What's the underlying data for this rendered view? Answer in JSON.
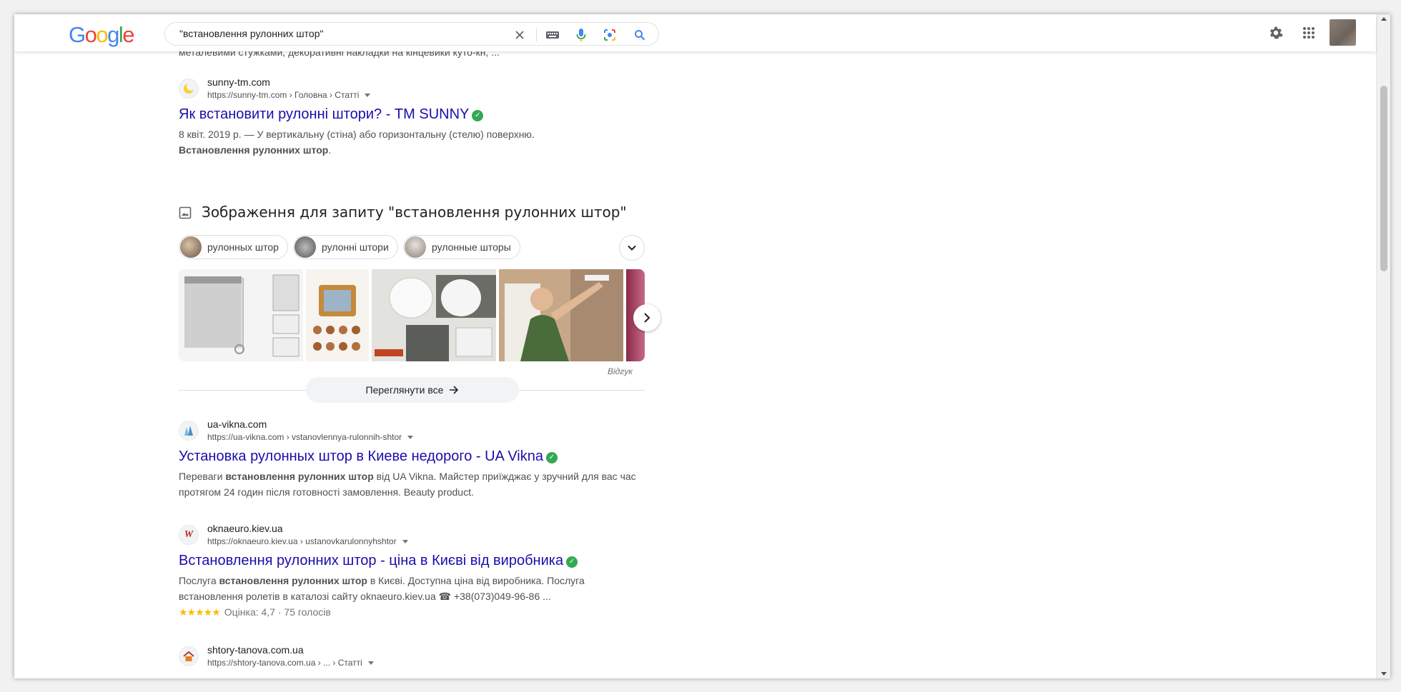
{
  "header": {
    "logo_letters": [
      {
        "ch": "G",
        "color": "#4285f4"
      },
      {
        "ch": "o",
        "color": "#ea4335"
      },
      {
        "ch": "o",
        "color": "#fbbc05"
      },
      {
        "ch": "g",
        "color": "#4285f4"
      },
      {
        "ch": "l",
        "color": "#34a853"
      },
      {
        "ch": "e",
        "color": "#ea4335"
      }
    ],
    "search_query": "\"встановлення рулонних штор\"",
    "icons": [
      "clear-icon",
      "keyboard-icon",
      "microphone-icon",
      "lens-icon",
      "search-icon",
      "gear-icon",
      "apps-icon"
    ]
  },
  "cut_off_snippet": "металевими стужками, декоративні накладки на кінцевики куто-кн, ...",
  "results": [
    {
      "site_name": "sunny-tm.com",
      "url": "https://sunny-tm.com › Головна › Статті",
      "title": "Як встановити рулонні штори? - ТМ SUNNY",
      "snippet_before": "8 квіт. 2019 р. — У вертикальну (стіна) або горизонтальну (стелю) поверхню.",
      "snippet_bold": "Встановлення рулонних штор",
      "snippet_after": "."
    },
    {
      "site_name": "ua-vikna.com",
      "url": "https://ua-vikna.com › vstanovlennya-rulonnih-shtor",
      "title": "Установка рулонных штор в Киеве недорого - UA Vikna",
      "snippet_before": "Переваги ",
      "snippet_bold": "встановлення рулонних штор",
      "snippet_after": " від UA Vikna. Майстер приїжджає у зручний для вас час протягом 24 годин після готовності замовлення. Beauty product."
    },
    {
      "site_name": "oknaeuro.kiev.ua",
      "url": "https://oknaeuro.kiev.ua › ustanovkarulonnyhshtor",
      "title": "Встановлення рулонних штор - ціна в Києві від виробника",
      "snippet_before": "Послуга ",
      "snippet_bold": "встановлення рулонних штор",
      "snippet_after": " в Києві. Доступна ціна від виробника. Послуга встановлення ролетів в каталозі сайту oknaeuro.kiev.ua ☎ +38(073)049-96-86 ...",
      "rating_stars": "★★★★★",
      "rating_text": "Оцінка: 4,7 · 75 голосів",
      "rating_value": 4.7
    },
    {
      "site_name": "shtory-tanova.com.ua",
      "url": "https://shtory-tanova.com.ua › ... › Статті"
    }
  ],
  "images": {
    "heading": "Зображення для запиту \"встановлення рулонних штор\"",
    "chips": [
      "рулонных штор",
      "рулонні штори",
      "рулонные шторы"
    ],
    "feedback": "Відгук",
    "see_all": "Переглянути все"
  }
}
